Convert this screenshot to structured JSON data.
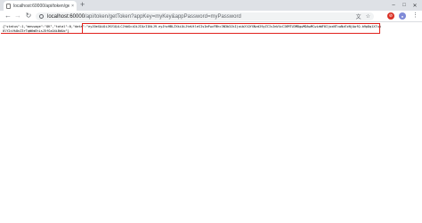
{
  "browser": {
    "tab_title": "localhost:60000/api/token/ge",
    "tab_close": "×",
    "new_tab": "+",
    "window_controls": {
      "minimize": "–",
      "maximize": "□",
      "close": "✕"
    },
    "nav": {
      "back": "←",
      "forward": "→",
      "reload": "↻"
    },
    "url_host": "localhost:60000",
    "url_path": "/api/token/getToken?appKey=myKey&appPassword=myPassword",
    "omnibox_actions": {
      "translate": "文",
      "bookmark": "☆"
    },
    "extensions": {
      "block": "⊘",
      "profile": "●"
    },
    "menu": "⋮",
    "icons": [
      "info-icon",
      "back-arrow-icon",
      "forward-arrow-icon",
      "reload-icon",
      "translate-icon",
      "star-icon",
      "block-icon",
      "profile-icon",
      "menu-icon"
    ]
  },
  "page": {
    "json_prefix": "{\"status\":1,\"message\":\"OK\",\"total\":0,\"data\":\"",
    "token": "eyJ0eXAiOiJKV1QiLCJhbGciOiJIUzI1NiJ9.eyJhcHBLZXkiOiJteUtleSIsImFwcFBhc3N3b3JkIjoibXlQYXNzd29yZCIsImV4cCI6MTU3MDgwMDAwMCwiaWF0IjoxNTcwNzEzNjAwfQ.b9pDq1X7uA0lY2cVk8nZ3rTqW6mEhLsJ5fGxO4iBdUo",
    "json_suffix": "\"}",
    "highlight_color": "#e0211c"
  }
}
